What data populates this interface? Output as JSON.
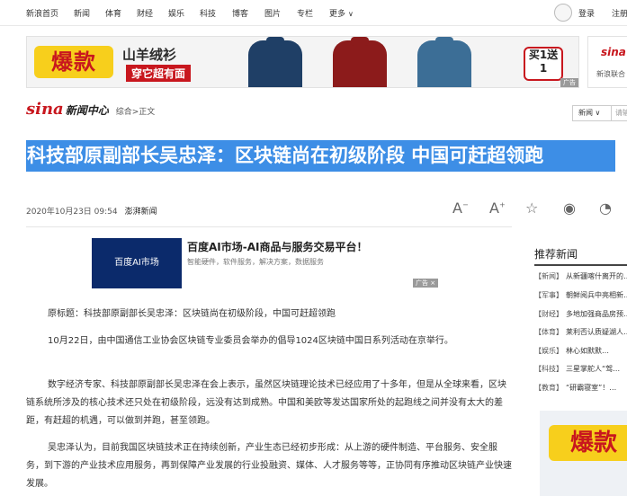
{
  "topnav": {
    "items": [
      "新浪首页",
      "新闻",
      "体育",
      "财经",
      "娱乐",
      "科技",
      "博客",
      "图片",
      "专栏",
      "更多"
    ],
    "login": "登录",
    "register": "注册"
  },
  "ad_banner": {
    "big_text": "爆款",
    "title": "山羊绒衫",
    "subtitle": "穿它超有面",
    "badge": "买1送1",
    "mark": "广告",
    "sweater_colors": [
      "#1f3f66",
      "#8c1b1b",
      "#3c6e96"
    ]
  },
  "side_ad": {
    "logo": "sina",
    "text": "新浪联合"
  },
  "brand": {
    "sina": "sina",
    "center": "新闻中心",
    "breadcrumb": "综合>正文"
  },
  "search": {
    "select": "新闻",
    "placeholder": "请输入"
  },
  "article": {
    "headline": "科技部原副部长吴忠泽：区块链尚在初级阶段 中国可赶超领跑",
    "date": "2020年10月23日 09:54",
    "source": "澎湃新闻",
    "paragraphs": [
      "原标题：科技部原副部长吴忠泽：区块链尚在初级阶段，中国可赶超领跑",
      "10月22日，由中国通信工业协会区块链专业委员会举办的倡导1024区块链中国日系列活动在京举行。",
      "数字经济专家、科技部原副部长吴忠泽在会上表示，虽然区块链理论技术已经应用了十多年，但是从全球来看，区块链系统所涉及的核心技术还只处在初级阶段，远没有达到成熟。中国和美欧等发达国家所处的起跑线之间并没有太大的差距，有赶超的机遇，可以做到并跑，甚至领跑。",
      "吴忠泽认为，目前我国区块链技术正在持续创新，产业生态已经初步形成：从上游的硬件制造、平台服务、安全服务，到下游的产业技术应用服务，再到保障产业发展的行业投融资、媒体、人才服务等等，正协同有序推动区块链产业快速发展。"
    ]
  },
  "baidu_ad": {
    "thumb": "百度AI市场",
    "title": "百度AI市场-AI商品与服务交易平台！",
    "desc": "智能硬件，软件服务，解决方案，数据服务",
    "mark": "广告"
  },
  "recommend": {
    "title": "推荐新闻",
    "items": [
      {
        "cat": "【新闻】",
        "text": "从新疆喀什离开的…"
      },
      {
        "cat": "【军事】",
        "text": "朝鲜阅兵中亮相新…"
      },
      {
        "cat": "【财经】",
        "text": "多地加强商品房预…"
      },
      {
        "cat": "【体育】",
        "text": "莱利否认质疑湖人…"
      },
      {
        "cat": "【娱乐】",
        "text": "林心如默默…"
      },
      {
        "cat": "【科技】",
        "text": "三星掌舵人“驾…"
      },
      {
        "cat": "【教育】",
        "text": "“研霸寝室”！…"
      }
    ]
  },
  "rec_ad": {
    "big_text": "爆款"
  }
}
